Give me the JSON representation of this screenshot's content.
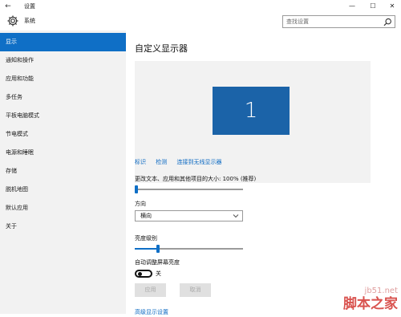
{
  "window": {
    "title": "设置",
    "back_symbol": "←",
    "minimize_symbol": "—",
    "maximize_symbol": "☐",
    "close_symbol": "✕"
  },
  "header": {
    "title": "系统",
    "search_placeholder": "查找设置",
    "gear_icon": "gear-icon",
    "search_icon": "search-icon"
  },
  "sidebar": {
    "items": [
      {
        "label": "显示",
        "active": true
      },
      {
        "label": "通知和操作",
        "active": false
      },
      {
        "label": "应用和功能",
        "active": false
      },
      {
        "label": "多任务",
        "active": false
      },
      {
        "label": "平板电脑模式",
        "active": false
      },
      {
        "label": "节电模式",
        "active": false
      },
      {
        "label": "电源和睡眠",
        "active": false
      },
      {
        "label": "存储",
        "active": false
      },
      {
        "label": "脱机地图",
        "active": false
      },
      {
        "label": "默认应用",
        "active": false
      },
      {
        "label": "关于",
        "active": false
      }
    ]
  },
  "main": {
    "title": "自定义显示器",
    "monitor_number": "1",
    "links": [
      "标识",
      "检测",
      "连接到无线显示器"
    ],
    "scale_label": "更改文本、应用和其他项目的大小: 100% (推荐)",
    "scale_value_fraction": 0,
    "orientation_label": "方向",
    "orientation_value": "横向",
    "brightness_label": "亮度级别",
    "brightness_fraction": 0.2,
    "auto_brightness_label": "自动调整屏幕亮度",
    "toggle_state": "关",
    "apply_button": "应用",
    "cancel_button": "取消",
    "advanced_link": "高级显示设置"
  },
  "watermark": {
    "site": "jb51.net",
    "name": "脚本之家"
  },
  "colors": {
    "accent": "#0f6fc6",
    "link": "#0a68c2",
    "sidebar_bg": "#f2f2f2",
    "monitor": "#1b63a8"
  }
}
